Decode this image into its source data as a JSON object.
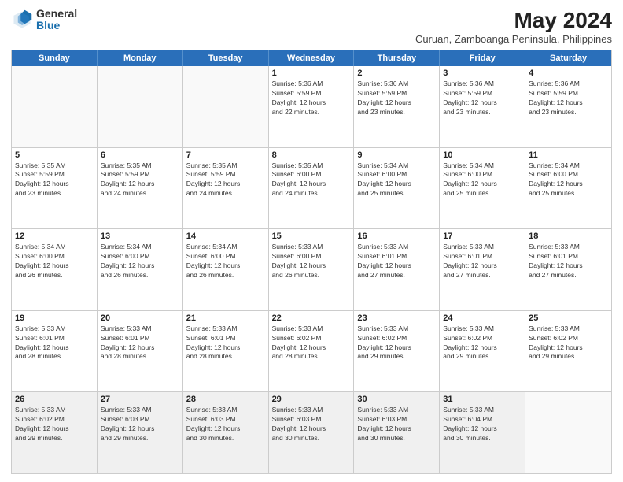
{
  "logo": {
    "general": "General",
    "blue": "Blue"
  },
  "title": "May 2024",
  "subtitle": "Curuan, Zamboanga Peninsula, Philippines",
  "header_days": [
    "Sunday",
    "Monday",
    "Tuesday",
    "Wednesday",
    "Thursday",
    "Friday",
    "Saturday"
  ],
  "rows": [
    [
      {
        "day": "",
        "info": ""
      },
      {
        "day": "",
        "info": ""
      },
      {
        "day": "",
        "info": ""
      },
      {
        "day": "1",
        "info": "Sunrise: 5:36 AM\nSunset: 5:59 PM\nDaylight: 12 hours\nand 22 minutes."
      },
      {
        "day": "2",
        "info": "Sunrise: 5:36 AM\nSunset: 5:59 PM\nDaylight: 12 hours\nand 23 minutes."
      },
      {
        "day": "3",
        "info": "Sunrise: 5:36 AM\nSunset: 5:59 PM\nDaylight: 12 hours\nand 23 minutes."
      },
      {
        "day": "4",
        "info": "Sunrise: 5:36 AM\nSunset: 5:59 PM\nDaylight: 12 hours\nand 23 minutes."
      }
    ],
    [
      {
        "day": "5",
        "info": "Sunrise: 5:35 AM\nSunset: 5:59 PM\nDaylight: 12 hours\nand 23 minutes."
      },
      {
        "day": "6",
        "info": "Sunrise: 5:35 AM\nSunset: 5:59 PM\nDaylight: 12 hours\nand 24 minutes."
      },
      {
        "day": "7",
        "info": "Sunrise: 5:35 AM\nSunset: 5:59 PM\nDaylight: 12 hours\nand 24 minutes."
      },
      {
        "day": "8",
        "info": "Sunrise: 5:35 AM\nSunset: 6:00 PM\nDaylight: 12 hours\nand 24 minutes."
      },
      {
        "day": "9",
        "info": "Sunrise: 5:34 AM\nSunset: 6:00 PM\nDaylight: 12 hours\nand 25 minutes."
      },
      {
        "day": "10",
        "info": "Sunrise: 5:34 AM\nSunset: 6:00 PM\nDaylight: 12 hours\nand 25 minutes."
      },
      {
        "day": "11",
        "info": "Sunrise: 5:34 AM\nSunset: 6:00 PM\nDaylight: 12 hours\nand 25 minutes."
      }
    ],
    [
      {
        "day": "12",
        "info": "Sunrise: 5:34 AM\nSunset: 6:00 PM\nDaylight: 12 hours\nand 26 minutes."
      },
      {
        "day": "13",
        "info": "Sunrise: 5:34 AM\nSunset: 6:00 PM\nDaylight: 12 hours\nand 26 minutes."
      },
      {
        "day": "14",
        "info": "Sunrise: 5:34 AM\nSunset: 6:00 PM\nDaylight: 12 hours\nand 26 minutes."
      },
      {
        "day": "15",
        "info": "Sunrise: 5:33 AM\nSunset: 6:00 PM\nDaylight: 12 hours\nand 26 minutes."
      },
      {
        "day": "16",
        "info": "Sunrise: 5:33 AM\nSunset: 6:01 PM\nDaylight: 12 hours\nand 27 minutes."
      },
      {
        "day": "17",
        "info": "Sunrise: 5:33 AM\nSunset: 6:01 PM\nDaylight: 12 hours\nand 27 minutes."
      },
      {
        "day": "18",
        "info": "Sunrise: 5:33 AM\nSunset: 6:01 PM\nDaylight: 12 hours\nand 27 minutes."
      }
    ],
    [
      {
        "day": "19",
        "info": "Sunrise: 5:33 AM\nSunset: 6:01 PM\nDaylight: 12 hours\nand 28 minutes."
      },
      {
        "day": "20",
        "info": "Sunrise: 5:33 AM\nSunset: 6:01 PM\nDaylight: 12 hours\nand 28 minutes."
      },
      {
        "day": "21",
        "info": "Sunrise: 5:33 AM\nSunset: 6:01 PM\nDaylight: 12 hours\nand 28 minutes."
      },
      {
        "day": "22",
        "info": "Sunrise: 5:33 AM\nSunset: 6:02 PM\nDaylight: 12 hours\nand 28 minutes."
      },
      {
        "day": "23",
        "info": "Sunrise: 5:33 AM\nSunset: 6:02 PM\nDaylight: 12 hours\nand 29 minutes."
      },
      {
        "day": "24",
        "info": "Sunrise: 5:33 AM\nSunset: 6:02 PM\nDaylight: 12 hours\nand 29 minutes."
      },
      {
        "day": "25",
        "info": "Sunrise: 5:33 AM\nSunset: 6:02 PM\nDaylight: 12 hours\nand 29 minutes."
      }
    ],
    [
      {
        "day": "26",
        "info": "Sunrise: 5:33 AM\nSunset: 6:02 PM\nDaylight: 12 hours\nand 29 minutes."
      },
      {
        "day": "27",
        "info": "Sunrise: 5:33 AM\nSunset: 6:03 PM\nDaylight: 12 hours\nand 29 minutes."
      },
      {
        "day": "28",
        "info": "Sunrise: 5:33 AM\nSunset: 6:03 PM\nDaylight: 12 hours\nand 30 minutes."
      },
      {
        "day": "29",
        "info": "Sunrise: 5:33 AM\nSunset: 6:03 PM\nDaylight: 12 hours\nand 30 minutes."
      },
      {
        "day": "30",
        "info": "Sunrise: 5:33 AM\nSunset: 6:03 PM\nDaylight: 12 hours\nand 30 minutes."
      },
      {
        "day": "31",
        "info": "Sunrise: 5:33 AM\nSunset: 6:04 PM\nDaylight: 12 hours\nand 30 minutes."
      },
      {
        "day": "",
        "info": ""
      }
    ]
  ]
}
